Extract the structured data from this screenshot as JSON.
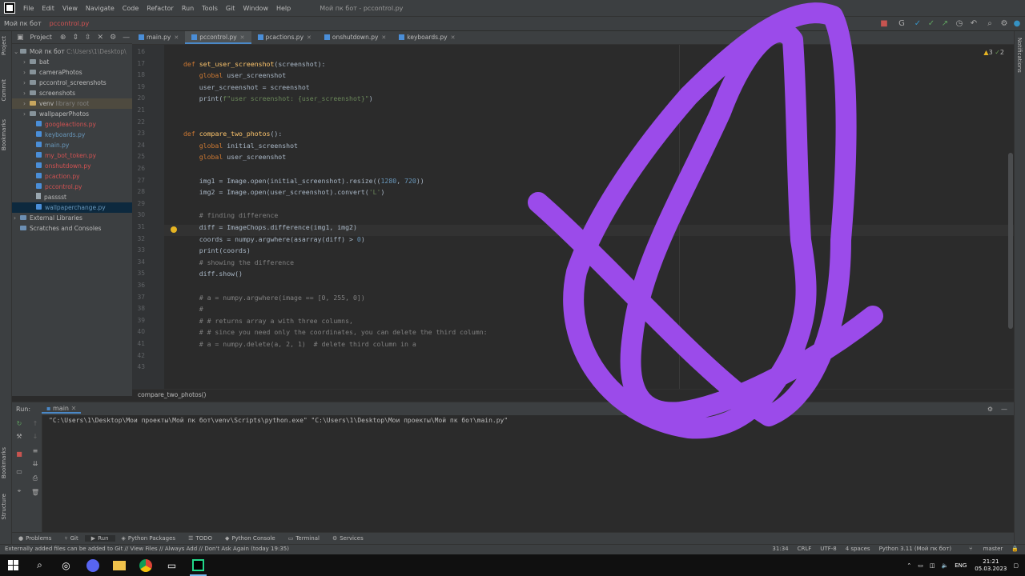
{
  "menu": {
    "items": [
      "File",
      "Edit",
      "View",
      "Navigate",
      "Code",
      "Refactor",
      "Run",
      "Tools",
      "Git",
      "Window",
      "Help"
    ],
    "window_title": "Мой пк бот - pccontrol.py"
  },
  "navbar": {
    "project": "Мой пк бот",
    "file": "pccontrol.py"
  },
  "project_panel": {
    "label": "Project",
    "root": "Мой пк бот",
    "root_path": "C:\\Users\\1\\Desktop\\",
    "items": [
      {
        "name": "bat",
        "kind": "folder"
      },
      {
        "name": "cameraPhotos",
        "kind": "folder"
      },
      {
        "name": "pccontrol_screenshots",
        "kind": "folder"
      },
      {
        "name": "screenshots",
        "kind": "folder"
      },
      {
        "name": "venv",
        "extra": "library root",
        "kind": "folder"
      },
      {
        "name": "wallpaperPhotos",
        "kind": "folder"
      },
      {
        "name": "googleactions.py",
        "kind": "py"
      },
      {
        "name": "keyboards.py",
        "kind": "py"
      },
      {
        "name": "main.py",
        "kind": "py"
      },
      {
        "name": "my_bot_token.py",
        "kind": "py"
      },
      {
        "name": "onshutdown.py",
        "kind": "py"
      },
      {
        "name": "pcaction.py",
        "kind": "py"
      },
      {
        "name": "pccontrol.py",
        "kind": "py"
      },
      {
        "name": "passsst",
        "kind": "txt"
      },
      {
        "name": "wallpaperchange.py",
        "kind": "py"
      },
      {
        "name": "External Libraries",
        "kind": "lib"
      },
      {
        "name": "Scratches and Consoles",
        "kind": "scratch"
      }
    ]
  },
  "tabs": [
    "main.py",
    "pccontrol.py",
    "pcactions.py",
    "onshutdown.py",
    "keyboards.py"
  ],
  "editor": {
    "warnings": "3",
    "checks": "2",
    "line_numbers": [
      "16",
      "17",
      "18",
      "19",
      "20",
      "21",
      "22",
      "23",
      "24",
      "25",
      "26",
      "27",
      "28",
      "29",
      "30",
      "31",
      "32",
      "33",
      "34",
      "35",
      "36",
      "37",
      "38",
      "39",
      "40",
      "41",
      "42",
      "43"
    ],
    "lines": [
      "",
      "def set_user_screenshot(screenshot):",
      "    global user_screenshot",
      "    user_screenshot = screenshot",
      "    print(f\"user screenshot: {user_screenshot}\")",
      "",
      "",
      "def compare_two_photos():",
      "    global initial_screenshot",
      "    global user_screenshot",
      "",
      "    img1 = Image.open(initial_screenshot).resize((1280, 720))",
      "    img2 = Image.open(user_screenshot).convert('L')",
      "",
      "    # finding difference",
      "    diff = ImageChops.difference(img1, img2)",
      "    coords = numpy.argwhere(asarray(diff) > 0)",
      "    print(coords)",
      "    # showing the difference",
      "    diff.show()",
      "",
      "    # a = numpy.argwhere(image == [0, 255, 0])",
      "    #",
      "    # # returns array a with three columns,",
      "    # # since you need only the coordinates, you can delete the third column:",
      "    # a = numpy.delete(a, 2, 1)  # delete third column in a",
      "",
      ""
    ],
    "breadcrumb": "compare_two_photos()"
  },
  "run": {
    "label": "Run:",
    "tab": "main",
    "console_line": "\"C:\\Users\\1\\Desktop\\Мои проекты\\Мой пк бот\\venv\\Scripts\\python.exe\" \"C:\\Users\\1\\Desktop\\Мои проекты\\Мой пк бот\\main.py\""
  },
  "tool_tabs": [
    "Problems",
    "Git",
    "Run",
    "Python Packages",
    "TODO",
    "Python Console",
    "Terminal",
    "Services"
  ],
  "left_strip": [
    "Project",
    "Commit",
    "Bookmarks"
  ],
  "left_strip_bottom": [
    "Bookmarks",
    "Structure"
  ],
  "right_strip": [
    "Notifications"
  ],
  "status": {
    "message": "Externally added files can be added to Git // View Files // Always Add // Don't Ask Again (today 19:35)",
    "position": "31:34",
    "line_sep": "CRLF",
    "encoding": "UTF-8",
    "indent": "4 spaces",
    "interpreter": "Python 3.11 (Мой пк бот)",
    "branch": "master"
  },
  "taskbar": {
    "lang": "ENG",
    "time": "21:21",
    "date": "05.03.2023"
  },
  "colors": {
    "scribble": "#9b4bea",
    "accent": "#4a88c7"
  }
}
